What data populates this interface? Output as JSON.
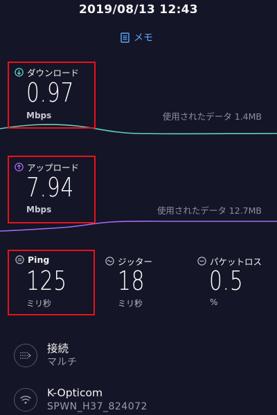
{
  "header": {
    "timestamp": "2019/08/13 12:43",
    "memo_label": "メモ"
  },
  "download": {
    "label": "ダウンロード",
    "value": "0.97",
    "unit": "Mbps",
    "data_used": "使用されたデータ 1.4MB",
    "accent_color": "#5fd3c7"
  },
  "upload": {
    "label": "アップロード",
    "value": "7.94",
    "unit": "Mbps",
    "data_used": "使用されたデータ 12.7MB",
    "accent_color": "#a56cf5"
  },
  "stats": [
    {
      "name": "ping",
      "label": "Ping",
      "value": "125",
      "unit": "ミリ秒"
    },
    {
      "name": "jitter",
      "label": "ジッター",
      "value": "18",
      "unit": "ミリ秒"
    },
    {
      "name": "packet-loss",
      "label": "パケットロス",
      "value": "0.5",
      "unit": "%"
    }
  ],
  "connection": {
    "title": "接続",
    "subtitle": "マルチ"
  },
  "network": {
    "title": "K-Opticom",
    "subtitle": "SPWN_H37_824072"
  },
  "colors": {
    "background": "#141526",
    "highlight_box": "#e8131b",
    "memo_link": "#5aa8ff"
  },
  "icons": {
    "memo": "memo-icon",
    "download": "download-arrow-icon",
    "upload": "upload-arrow-icon",
    "ping": "ping-icon",
    "jitter": "jitter-icon",
    "packet_loss": "packet-loss-icon",
    "connection": "connections-icon",
    "wifi": "wifi-icon"
  }
}
